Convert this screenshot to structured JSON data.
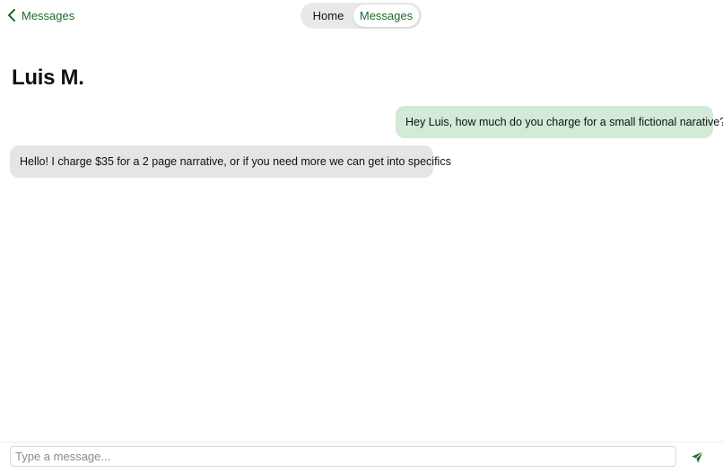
{
  "nav": {
    "back_label": "Messages",
    "back_icon": "chevron-left-icon"
  },
  "segmented": {
    "home_label": "Home",
    "messages_label": "Messages",
    "selected": "Messages"
  },
  "conversation": {
    "contact_name": "Luis M.",
    "messages": [
      {
        "direction": "outgoing",
        "text": "Hey Luis, how much do you charge for a small fictional narative?"
      },
      {
        "direction": "incoming",
        "text": "Hello! I charge $35 for a 2 page narrative, or if you need more we can get into specifics"
      }
    ]
  },
  "composer": {
    "placeholder": "Type a message...",
    "value": "",
    "send_icon": "send-icon"
  },
  "colors": {
    "accent": "#1f6b2a",
    "outgoing_bubble": "#d3ead6",
    "incoming_bubble": "#e5e5e6",
    "segmented_bg": "#e9e9ea"
  }
}
